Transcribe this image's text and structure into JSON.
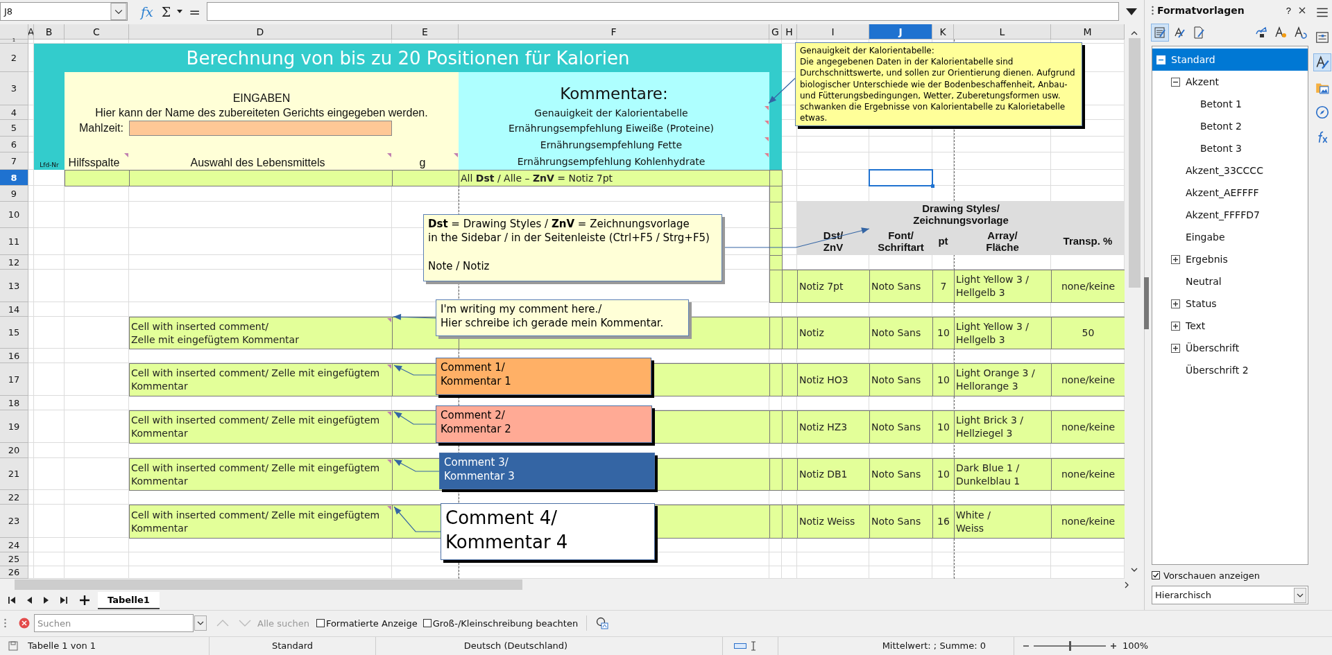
{
  "formula_bar": {
    "name_box": "J8",
    "function_wizard": "fx",
    "sum": "Σ",
    "formula": "="
  },
  "columns": [
    {
      "label": "A",
      "selected": false
    },
    {
      "label": "B",
      "selected": false
    },
    {
      "label": "C",
      "selected": false
    },
    {
      "label": "D",
      "selected": false
    },
    {
      "label": "E",
      "selected": false
    },
    {
      "label": "F",
      "selected": false
    },
    {
      "label": "G",
      "selected": false
    },
    {
      "label": "H",
      "selected": false
    },
    {
      "label": "I",
      "selected": false
    },
    {
      "label": "J",
      "selected": true
    },
    {
      "label": "K",
      "selected": false
    },
    {
      "label": "L",
      "selected": false
    },
    {
      "label": "M",
      "selected": false
    }
  ],
  "rows": [
    {
      "label": "1",
      "selected": false
    },
    {
      "label": "2",
      "selected": false
    },
    {
      "label": "3",
      "selected": false
    },
    {
      "label": "4",
      "selected": false
    },
    {
      "label": "5",
      "selected": false
    },
    {
      "label": "6",
      "selected": false
    },
    {
      "label": "7",
      "selected": false
    },
    {
      "label": "8",
      "selected": true
    },
    {
      "label": "9",
      "selected": false
    },
    {
      "label": "10",
      "selected": false
    },
    {
      "label": "11",
      "selected": false
    },
    {
      "label": "12",
      "selected": false
    },
    {
      "label": "13",
      "selected": false
    },
    {
      "label": "14",
      "selected": false
    },
    {
      "label": "15",
      "selected": false
    },
    {
      "label": "16",
      "selected": false
    },
    {
      "label": "17",
      "selected": false
    },
    {
      "label": "18",
      "selected": false
    },
    {
      "label": "19",
      "selected": false
    },
    {
      "label": "20",
      "selected": false
    },
    {
      "label": "21",
      "selected": false
    },
    {
      "label": "22",
      "selected": false
    },
    {
      "label": "23",
      "selected": false
    },
    {
      "label": "24",
      "selected": false
    },
    {
      "label": "25",
      "selected": false
    },
    {
      "label": "26",
      "selected": false
    }
  ],
  "title": "Berechnung von bis zu 20 Positionen für Kalorien",
  "inputs": {
    "heading": "EINGABEN",
    "hint": "Hier kann der Name des zubereiteten Gerichts eingegeben werden.",
    "meal_label": "Mahlzeit:",
    "row_number_label": "Lfd-Nr",
    "columns": [
      {
        "label": "Hilfsspalte",
        "comment": true
      },
      {
        "label": "Auswahl des Lebensmittels",
        "comment": true
      },
      {
        "label": "g",
        "comment": true
      }
    ]
  },
  "comment_panel": {
    "heading": "Kommentare:",
    "lines": [
      {
        "text": "Genauigkeit der Kalorientabelle",
        "comment": true
      },
      {
        "text": "Ernährungsempfehlung Eiweiße (Proteine)",
        "comment": true
      },
      {
        "text": "Ernährungsempfehlung Fette",
        "comment": true
      },
      {
        "text": "Ernährungsempfehlung Kohlenhydrate",
        "comment": true
      }
    ]
  },
  "row_note": "All **Dst** / Alle – **ZnV** = Notiz 7pt",
  "styles_table": {
    "title": "Drawing Styles/\nZeichnungsvorlage",
    "columns": [
      "Dst/\nZnV",
      "Font/\nSchriftart",
      "pt",
      "Array/\nFläche",
      "Transp. %"
    ],
    "rows": [
      [
        "Notiz 7pt",
        "Noto Sans",
        "7",
        "Light Yellow 3 /\nHellgelb 3",
        "none/keine"
      ],
      [
        "Notiz",
        "Noto Sans",
        "10",
        "Light Yellow 3 /\nHellgelb 3",
        "50"
      ],
      [
        "Notiz HO3",
        "Noto Sans",
        "10",
        "Light Orange 3 /\nHellorange 3",
        "none/keine"
      ],
      [
        "Notiz HZ3",
        "Noto Sans",
        "10",
        "Light Brick 3 /\nHellziegel 3",
        "none/keine"
      ],
      [
        "Notiz DB1",
        "Noto Sans",
        "10",
        "Dark Blue 1 /\nDunkelblau 1",
        "none/keine"
      ],
      [
        "Notiz Weiss",
        "Noto Sans",
        "16",
        "White /\nWeiss",
        "none/keine"
      ]
    ]
  },
  "commented_cells": [
    {
      "text": "Cell with inserted comment/\nZelle mit eingefügtem Kommentar",
      "comment": true
    },
    {
      "text": "Cell with inserted comment/ Zelle mit eingefügtem Kommentar",
      "comment": true
    },
    {
      "text": "Cell with inserted comment/ Zelle mit eingefügtem Kommentar",
      "comment": true
    },
    {
      "text": "Cell with inserted comment/ Zelle mit eingefügtem Kommentar",
      "comment": true
    },
    {
      "text": "Cell with inserted comment/ Zelle mit eingefügtem Kommentar",
      "comment": true
    }
  ],
  "notes": [
    {
      "kind": "note",
      "color": "#ffff99",
      "text": "Genauigkeit der Kalorientabelle:\nDie angegebenen Daten in der Kalorientabelle sind Durchschnittswerte, und sollen zur Orientierung dienen. Aufgrund biologischer Unterschiede wie der Bodenbeschaffenheit, Anbau- und Fütterungsbedingungen, Wetter, Zuberetungsformen usw. schwanken die Ergebnisse von Kalorientabelle zu Kalorietabelle etwas."
    },
    {
      "kind": "note",
      "color": "#ffffd7",
      "text": "**Dst** = Drawing Styles / **ZnV** = Zeichnungsvorlage\nin the Sidebar / in der Seitenleiste (Ctrl+F5 / Strg+F5)\n\nNote / Notiz"
    },
    {
      "kind": "note",
      "color": "#ffffd7",
      "text": "I'm writing my comment here./\nHier schreibe ich gerade mein Kommentar."
    },
    {
      "kind": "comment",
      "color": "#ffb066",
      "text": "Comment 1/\nKommentar 1"
    },
    {
      "kind": "comment",
      "color": "#ffaa95",
      "text": "Comment 2/\nKommentar 2"
    },
    {
      "kind": "comment",
      "color": "#3465a4",
      "text": "Comment 3/\nKommentar 3"
    },
    {
      "kind": "comment",
      "color": "#ffffff",
      "text": "Comment 4/\nKommentar 4"
    }
  ],
  "sheet_tabs": [
    {
      "label": "Tabelle1",
      "selected": true
    }
  ],
  "find_bar": {
    "placeholder": "Suchen",
    "find_all": "Alle suchen",
    "options": [
      {
        "label": "Formatierte Anzeige",
        "checked": false
      },
      {
        "label": "Groß-/Kleinschreibung beachten",
        "checked": false
      }
    ]
  },
  "sidebar": {
    "title": "Formatvorlagen",
    "help": "?",
    "styles": [
      {
        "label": "Standard",
        "kind": "group",
        "expanded": true,
        "selected": true,
        "children": [
          {
            "label": "Akzent",
            "kind": "group",
            "expanded": true,
            "selected": false,
            "children": [
              {
                "label": "Betont 1",
                "kind": "leaf",
                "selected": false
              },
              {
                "label": "Betont 2",
                "kind": "leaf",
                "selected": false
              },
              {
                "label": "Betont 3",
                "kind": "leaf",
                "selected": false
              }
            ]
          },
          {
            "label": "Akzent_33CCCC",
            "kind": "leaf",
            "selected": false
          },
          {
            "label": "Akzent_AEFFFF",
            "kind": "leaf",
            "selected": false
          },
          {
            "label": "Akzent_FFFFD7",
            "kind": "leaf",
            "selected": false
          },
          {
            "label": "Eingabe",
            "kind": "leaf",
            "selected": false
          },
          {
            "label": "Ergebnis",
            "kind": "group",
            "expanded": false,
            "selected": false
          },
          {
            "label": "Neutral",
            "kind": "leaf",
            "selected": false
          },
          {
            "label": "Status",
            "kind": "group",
            "expanded": false,
            "selected": false
          },
          {
            "label": "Text",
            "kind": "group",
            "expanded": false,
            "selected": false
          },
          {
            "label": "Überschrift",
            "kind": "group",
            "expanded": false,
            "selected": false
          },
          {
            "label": "Überschrift 2",
            "kind": "leaf",
            "selected": false
          }
        ]
      }
    ],
    "preview": {
      "label": "Vorschauen anzeigen",
      "checked": true
    },
    "filter": "Hierarchisch"
  },
  "status_bar": {
    "sheet": "Tabelle 1 von 1",
    "page_style": "Standard",
    "language": "Deutsch (Deutschland)",
    "summary": "Mittelwert: ; Summe: 0",
    "zoom": "100%",
    "zoom_slider": {
      "level": 0.5
    }
  }
}
